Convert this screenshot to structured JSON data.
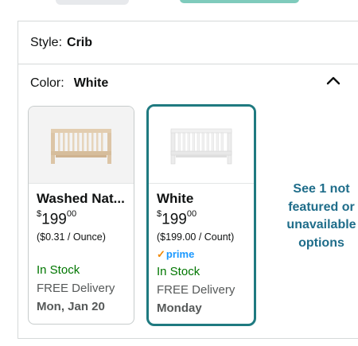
{
  "style": {
    "label": "Style:",
    "value": "Crib"
  },
  "color": {
    "label": "Color:",
    "value": "White"
  },
  "options": [
    {
      "title": "Washed Nat...",
      "price_symbol": "$",
      "price_whole": "199",
      "price_fraction": "00",
      "unit_price": "($0.31 / Ounce)",
      "prime": "",
      "availability": "In Stock",
      "delivery": "FREE Delivery",
      "delivery_date": "Mon, Jan 20",
      "selected": false
    },
    {
      "title": "White",
      "price_symbol": "$",
      "price_whole": "199",
      "price_fraction": "00",
      "unit_price": "($199.00 / Count)",
      "prime_check": "✓",
      "prime": "prime",
      "availability": "In Stock",
      "delivery": "FREE Delivery",
      "delivery_date": "Monday",
      "selected": true
    }
  ],
  "see_more": "See 1 not featured or unavailable options",
  "colors": {
    "selected_border": "#1f7a80",
    "in_stock": "#007600",
    "link": "#1f6d8a",
    "prime_blue": "#1a98ff",
    "prime_check": "#f08804"
  },
  "icons": {
    "collapse": "chevron-up-icon"
  }
}
